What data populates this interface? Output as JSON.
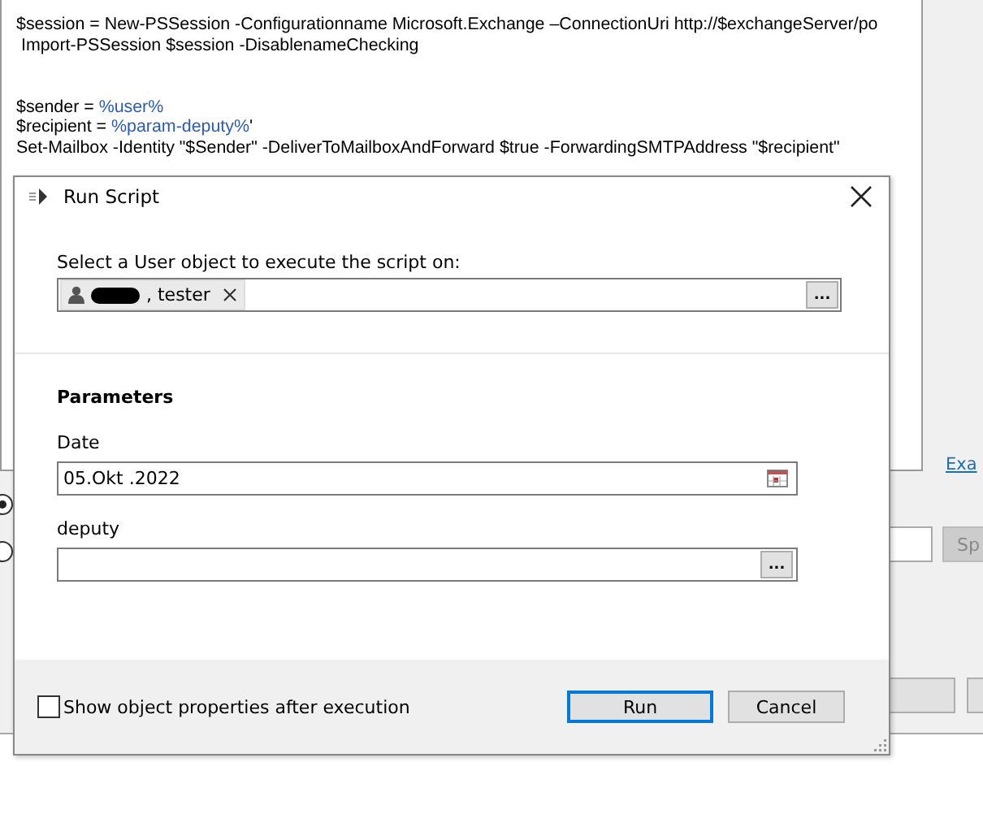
{
  "editor": {
    "lines": [
      {
        "kind": "code",
        "segments": [
          {
            "text": "$session = New-PSSession -Configurationname Microsoft.Exchange –ConnectionUri http://$exchangeServer/po",
            "kind": "plain"
          }
        ]
      },
      {
        "kind": "code",
        "segments": [
          {
            "text": " Import-PSSession $session -DisablenameChecking",
            "kind": "plain"
          }
        ]
      },
      {
        "kind": "blank"
      },
      {
        "kind": "blank"
      },
      {
        "kind": "code",
        "segments": [
          {
            "text": "$sender = ",
            "kind": "plain"
          },
          {
            "text": "%user%",
            "kind": "variable"
          }
        ]
      },
      {
        "kind": "code",
        "segments": [
          {
            "text": "$recipient = ",
            "kind": "plain"
          },
          {
            "text": "%param-deputy%",
            "kind": "variable"
          },
          {
            "text": "'",
            "kind": "plain"
          }
        ]
      },
      {
        "kind": "code",
        "segments": [
          {
            "text": "Set-Mailbox -Identity \"$Sender\" -DeliverToMailboxAndForward $true -ForwardingSMTPAddress \"$recipient\"",
            "kind": "plain"
          }
        ]
      }
    ]
  },
  "background": {
    "link": "Exa",
    "radios": [
      {
        "selected": true
      },
      {
        "selected": false
      }
    ],
    "side_button": "Sp"
  },
  "dialog": {
    "title": "Run Script",
    "object_label": "Select a User object to execute the script on:",
    "object_token": ", tester",
    "browse": "...",
    "parameters_heading": "Parameters",
    "parameters": [
      {
        "kind": "date",
        "label": "Date",
        "value": "05.Okt .2022"
      },
      {
        "kind": "picker",
        "label": "deputy",
        "button": "..."
      }
    ],
    "show_properties": {
      "label": "Show object properties after execution",
      "checked": false
    },
    "buttons": [
      {
        "label": "Run",
        "default": true
      },
      {
        "label": "Cancel",
        "default": false
      }
    ]
  }
}
